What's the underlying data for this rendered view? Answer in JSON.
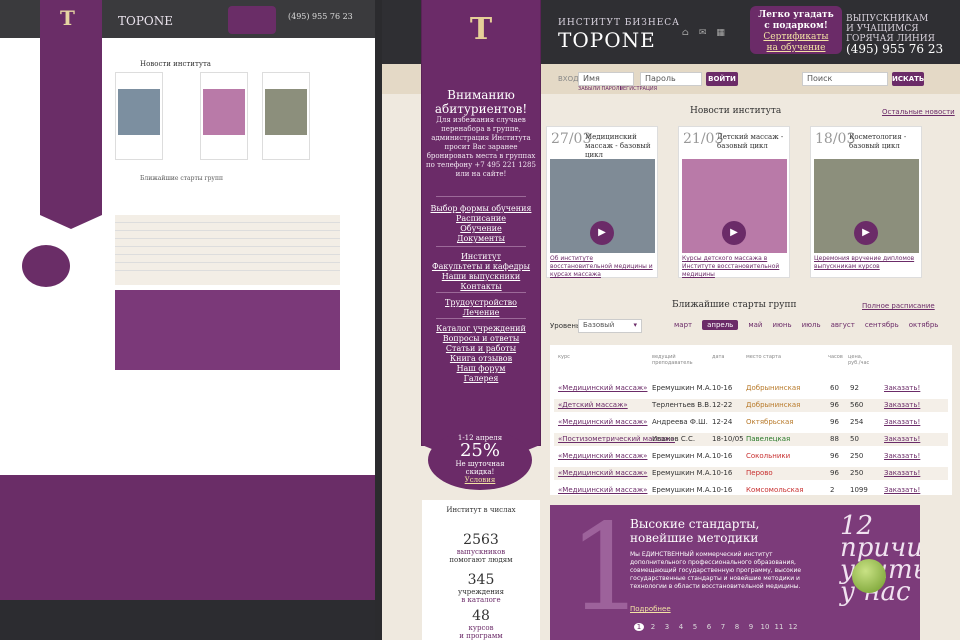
{
  "brand": {
    "subtitle": "ИНСТИТУТ БИЗНЕСА",
    "name": "TOPONE",
    "logo_letter": "T"
  },
  "header": {
    "cert_line1": "Легко угадать",
    "cert_line2": "с подарком!",
    "cert_link1": "Сертификаты",
    "cert_link2": "на обучение",
    "grad_line1": "ВЫПУСКНИКАМ",
    "grad_line2": "И УЧАЩИМСЯ",
    "grad_line3": "ГОРЯЧАЯ ЛИНИЯ",
    "phone": "(495) 955 76 23"
  },
  "login": {
    "label": "ВХОД",
    "name_placeholder": "Имя",
    "password_placeholder": "Пароль",
    "login_button": "ВОЙТИ",
    "forgot": "ЗАБЫЛИ ПАРОЛЬ",
    "register": "РЕГИСТРАЦИЯ",
    "search_placeholder": "Поиск",
    "search_button": "ИСКАТЬ"
  },
  "ribbon": {
    "title1": "Вниманию",
    "title2": "абитуриентов!",
    "text": "Для избежания случаев перенабора в группе, администрация Института просит Вас заранее бронировать места в группах по телефону +7 495 221 1285 или на сайте!",
    "menu1": [
      "Выбор формы обучения",
      "Расписание",
      "Обучение",
      "Документы"
    ],
    "menu2": [
      "Институт",
      "Факультеты и кафедры",
      "Наши выпускники",
      "Контакты"
    ],
    "menu3": [
      "Трудоустройство",
      "Лечение"
    ],
    "menu4": [
      "Каталог учреждений",
      "Вопросы и ответы",
      "Статьи и работы",
      "Книга отзывов",
      "Наш форум",
      "Галерея"
    ]
  },
  "sale": {
    "dates": "1-12 апреля",
    "percent": "25%",
    "line1": "Не шуточная",
    "line2": "скидка!",
    "link": "Условия"
  },
  "news": {
    "title": "Новости института",
    "all_link": "Остальные новости",
    "cards": [
      {
        "date": "27/03",
        "title": "Медицинский массаж - базовый цикл",
        "caption": "Об институте восстановительной медицины и курсах массажа",
        "color": "#7f8b96"
      },
      {
        "date": "21/03",
        "title": "Детский массаж - базовый цикл",
        "caption": "Курсы детского массажа в Институте восстановительной медицины",
        "color": "#b97aa8"
      },
      {
        "date": "18/03",
        "title": "Косметология - базовый цикл",
        "caption": "Церемония вручение дипломов выпускникам курсов",
        "color": "#8c8f7c"
      }
    ]
  },
  "starts": {
    "title": "Ближайшие старты групп",
    "full_schedule": "Полное расписание",
    "level_label": "Уровень",
    "level_value": "Базовый",
    "months": [
      "март",
      "апрель",
      "май",
      "июнь",
      "июль",
      "август",
      "сентябрь",
      "октябрь"
    ],
    "active_month": "апрель",
    "columns": [
      "курс",
      "ведущий преподаватель",
      "дата",
      "место старта",
      "часов",
      "цена, руб./час"
    ],
    "rows": [
      {
        "course": "«Медицинский массаж»",
        "teacher": "Еремушкин М.А.",
        "date": "10-16",
        "place": "Добрынинская",
        "hours": "60",
        "price": "92",
        "action": "Заказать!",
        "place_color": "#b87a2a"
      },
      {
        "course": "«Детский массаж»",
        "teacher": "Терлентьев В.В.",
        "date": "12-22",
        "place": "Добрынинская",
        "hours": "96",
        "price": "560",
        "action": "Заказать!",
        "place_color": "#b87a2a"
      },
      {
        "course": "«Медицинский массаж»",
        "teacher": "Андреева Ф.Ш.",
        "date": "12-24",
        "place": "Октябрьская",
        "hours": "96",
        "price": "254",
        "action": "Заказать!",
        "place_color": "#b87a2a"
      },
      {
        "course": "«Постизометрический массаж»",
        "teacher": "Иванов С.С.",
        "date": "18-10/05",
        "place": "Павелецкая",
        "hours": "88",
        "price": "50",
        "action": "Заказать!",
        "place_color": "#2a7a2a"
      },
      {
        "course": "«Медицинский массаж»",
        "teacher": "Еремушкин М.А.",
        "date": "10-16",
        "place": "Сокольники",
        "hours": "96",
        "price": "250",
        "action": "Заказать!",
        "place_color": "#c83030"
      },
      {
        "course": "«Медицинский массаж»",
        "teacher": "Еремушкин М.А.",
        "date": "10-16",
        "place": "Перово",
        "hours": "96",
        "price": "250",
        "action": "Заказать!",
        "place_color": "#c83030"
      },
      {
        "course": "«Медицинский массаж»",
        "teacher": "Еремушкин М.А.",
        "date": "10-16",
        "place": "Комсомольская",
        "hours": "2",
        "price": "1099",
        "action": "Заказать!",
        "place_color": "#c83030"
      }
    ]
  },
  "numbers": {
    "title": "Институт в числах",
    "n1": "2563",
    "t1a": "выпускников",
    "t1b": "помогают людям",
    "n2": "345",
    "t2a": "учреждения",
    "t2b": "в каталоге",
    "n3": "48",
    "t3a": "курсов",
    "t3b": "и программ"
  },
  "banner": {
    "big_number": "1",
    "heading": "Высокие стандарты, новейшие методики",
    "text": "Мы ЕДИНСТВЕННЫЙ коммерческий институт дополнительного профессионального образования, совмещающий государственную программу, высокие государственные стандарты и новейшие методики и технологии в области восстановительной медицины.",
    "more": "Подробнее",
    "right": "12 причин учиться у нас",
    "pages": [
      "1",
      "2",
      "3",
      "4",
      "5",
      "6",
      "7",
      "8",
      "9",
      "10",
      "11",
      "12"
    ],
    "current_page": "1"
  }
}
